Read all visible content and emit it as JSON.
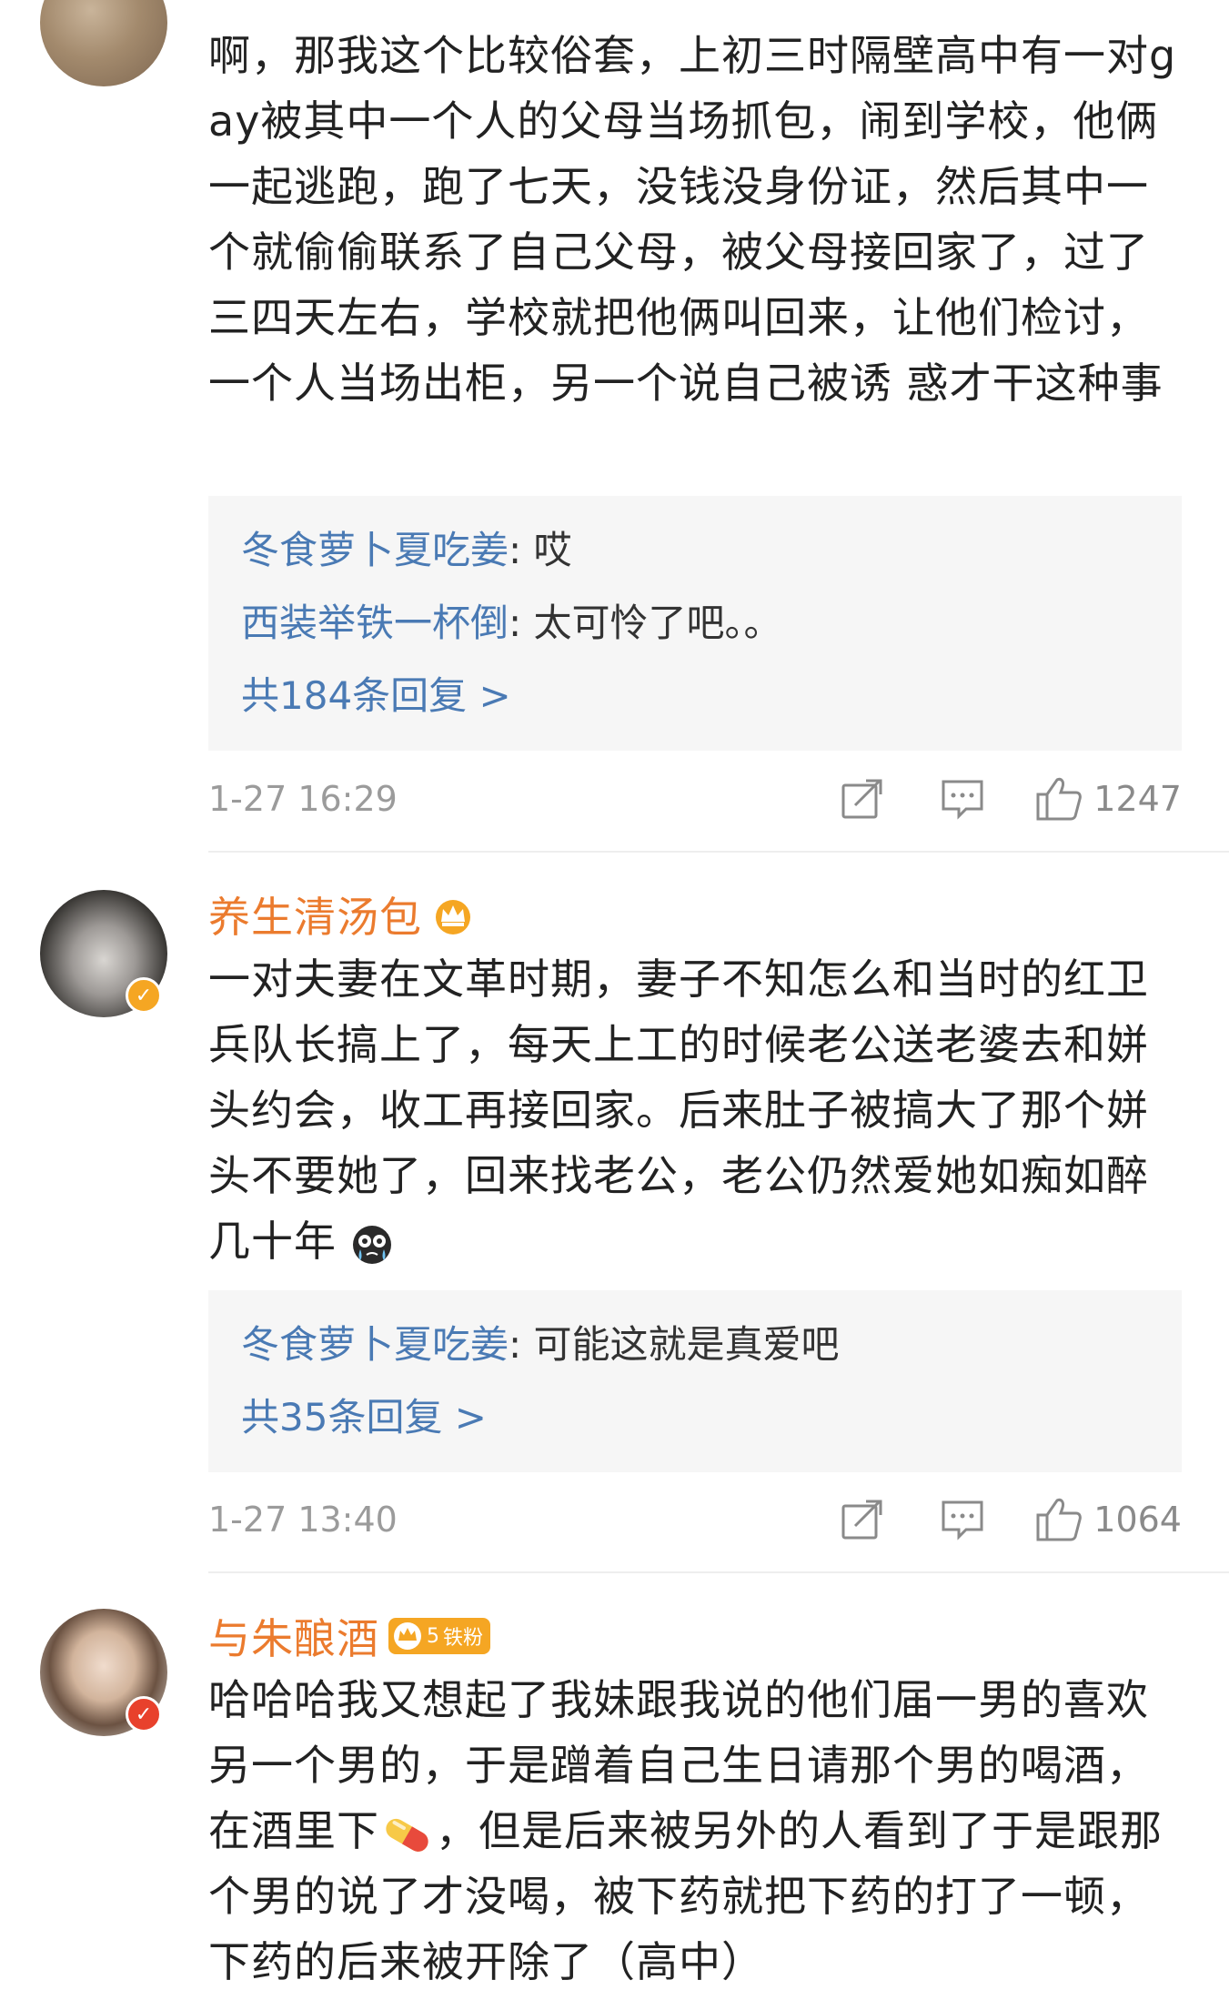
{
  "comments": [
    {
      "username": "",
      "text": "啊，那我这个比较俗套，上初三时隔壁高中有一对gay被其中一个人的父母当场抓包，闹到学校，他俩一起逃跑，跑了七天，没钱没身份证，然后其中一个就偷偷联系了自己父母，被父母接回家了，过了三四天左右，学校就把他俩叫回来，让他们检讨，一个人当场出柜，另一个说自己被诱 惑才干这种事",
      "replies": [
        {
          "author": "冬食萝卜夏吃姜",
          "text": "哎"
        },
        {
          "author": "西装举铁一杯倒",
          "text": "太可怜了吧。。"
        }
      ],
      "reply_more": "共184条回复 >",
      "timestamp": "1-27 16:29",
      "likes": "1247"
    },
    {
      "username": "养生清汤包",
      "text_before_emoji": "一对夫妻在文革时期，妻子不知怎么和当时的红卫兵队长搞上了，每天上工的时候老公送老婆去和姘头约会，收工再接回家。后来肚子被搞大了那个姘头不要她了，回来找老公，老公仍然爱她如痴如醉几十年",
      "emoji": "crying-face-emoji",
      "replies": [
        {
          "author": "冬食萝卜夏吃姜",
          "text": "可能这就是真爱吧"
        }
      ],
      "reply_more": "共35条回复 >",
      "timestamp": "1-27 13:40",
      "likes": "1064"
    },
    {
      "username": "与朱酿酒",
      "fan_badge": "铁粉",
      "fan_level": "5",
      "text_before_emoji": "哈哈哈我又想起了我妹跟我说的他们届一男的喜欢另一个男的，于是蹭着自己生日请那个男的喝酒，在酒里下",
      "emoji": "pill-emoji",
      "text_after_emoji": "，但是后来被另外的人看到了于是跟那个男的说了才没喝，被下药就把下药的打了一顿，下药的后来被开除了（高中）"
    }
  ],
  "colors": {
    "username": "#eb7b2e",
    "reply_author": "#4a7ab4",
    "reply_bg": "#f6f6f6",
    "meta": "#9b9b9b",
    "verified_gold": "#f5a623",
    "verified_red": "#e8412c"
  },
  "icons": {
    "share": "share-icon",
    "comment": "comment-icon",
    "like": "like-icon",
    "crown": "crown-icon",
    "verified": "verified-icon"
  }
}
